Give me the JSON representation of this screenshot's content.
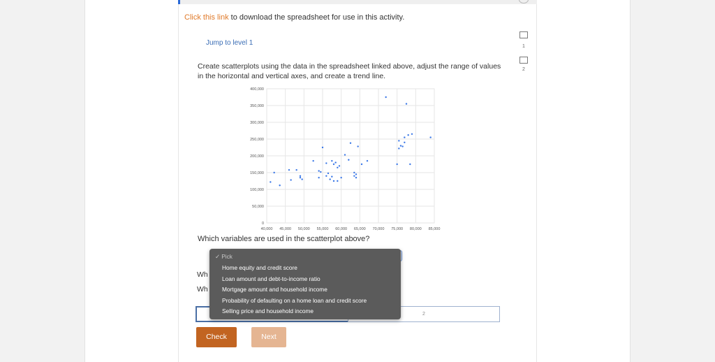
{
  "intro": {
    "link_text": "Click this link",
    "rest_text": " to download the spreadsheet for use in this activity."
  },
  "jump_link": "Jump to level 1",
  "instructions": "Create scatterplots using the data in the spreadsheet linked above, adjust the range of values in the horizontal and vertical axes, and create a trend line.",
  "sidebar": {
    "level_1": "1",
    "level_2": "2"
  },
  "question": "Which variables are used in the scatterplot above?",
  "question_stub_1": "Wh",
  "question_stub_2": "Wh",
  "answer_box_right_label": "2",
  "dropdown": {
    "placeholder": "✓ Pick",
    "options": [
      "Home equity and credit score",
      "Loan amount and debt-to-income ratio",
      "Mortgage amount and household income",
      "Probability of defaulting on a home loan and credit score",
      "Selling price and household income"
    ]
  },
  "buttons": {
    "check": "Check",
    "next": "Next"
  },
  "colors": {
    "accent_orange": "#c26421",
    "next_disabled": "#e5b592",
    "link_orange": "#e07a2a",
    "point_blue": "#3b78e7"
  },
  "chart_data": {
    "type": "scatter",
    "title": "",
    "xlabel": "",
    "ylabel": "",
    "xlim": [
      40000,
      85000
    ],
    "ylim": [
      0,
      400000
    ],
    "x_ticks": [
      "40,000",
      "45,000",
      "50,000",
      "55,000",
      "60,000",
      "65,000",
      "70,000",
      "75,000",
      "80,000",
      "85,000"
    ],
    "y_ticks": [
      "0",
      "50,000",
      "100,000",
      "150,000",
      "200,000",
      "250,000",
      "300,000",
      "350,000",
      "400,000"
    ],
    "grid": true,
    "points": [
      [
        41000,
        122000
      ],
      [
        42000,
        150000
      ],
      [
        43500,
        112000
      ],
      [
        46000,
        158000
      ],
      [
        46500,
        128000
      ],
      [
        48000,
        158000
      ],
      [
        49000,
        140000
      ],
      [
        49000,
        135000
      ],
      [
        49500,
        130000
      ],
      [
        52500,
        185000
      ],
      [
        54000,
        135000
      ],
      [
        54000,
        155000
      ],
      [
        54500,
        152000
      ],
      [
        55000,
        225000
      ],
      [
        56000,
        140000
      ],
      [
        56000,
        178000
      ],
      [
        56500,
        148000
      ],
      [
        57000,
        130000
      ],
      [
        57500,
        138000
      ],
      [
        57500,
        185000
      ],
      [
        58000,
        125000
      ],
      [
        58000,
        175000
      ],
      [
        58500,
        180000
      ],
      [
        59000,
        125000
      ],
      [
        59000,
        165000
      ],
      [
        59500,
        170000
      ],
      [
        60000,
        135000
      ],
      [
        61000,
        203000
      ],
      [
        62000,
        188000
      ],
      [
        62500,
        238000
      ],
      [
        63500,
        140000
      ],
      [
        63500,
        150000
      ],
      [
        64000,
        145000
      ],
      [
        64000,
        135000
      ],
      [
        64500,
        228000
      ],
      [
        65500,
        175000
      ],
      [
        67000,
        185000
      ],
      [
        72000,
        375000
      ],
      [
        75000,
        175000
      ],
      [
        75500,
        245000
      ],
      [
        75500,
        222000
      ],
      [
        76000,
        230000
      ],
      [
        76500,
        228000
      ],
      [
        77000,
        255000
      ],
      [
        77000,
        240000
      ],
      [
        77500,
        355000
      ],
      [
        78000,
        262000
      ],
      [
        78500,
        175000
      ],
      [
        79000,
        265000
      ],
      [
        84000,
        255000
      ]
    ]
  }
}
